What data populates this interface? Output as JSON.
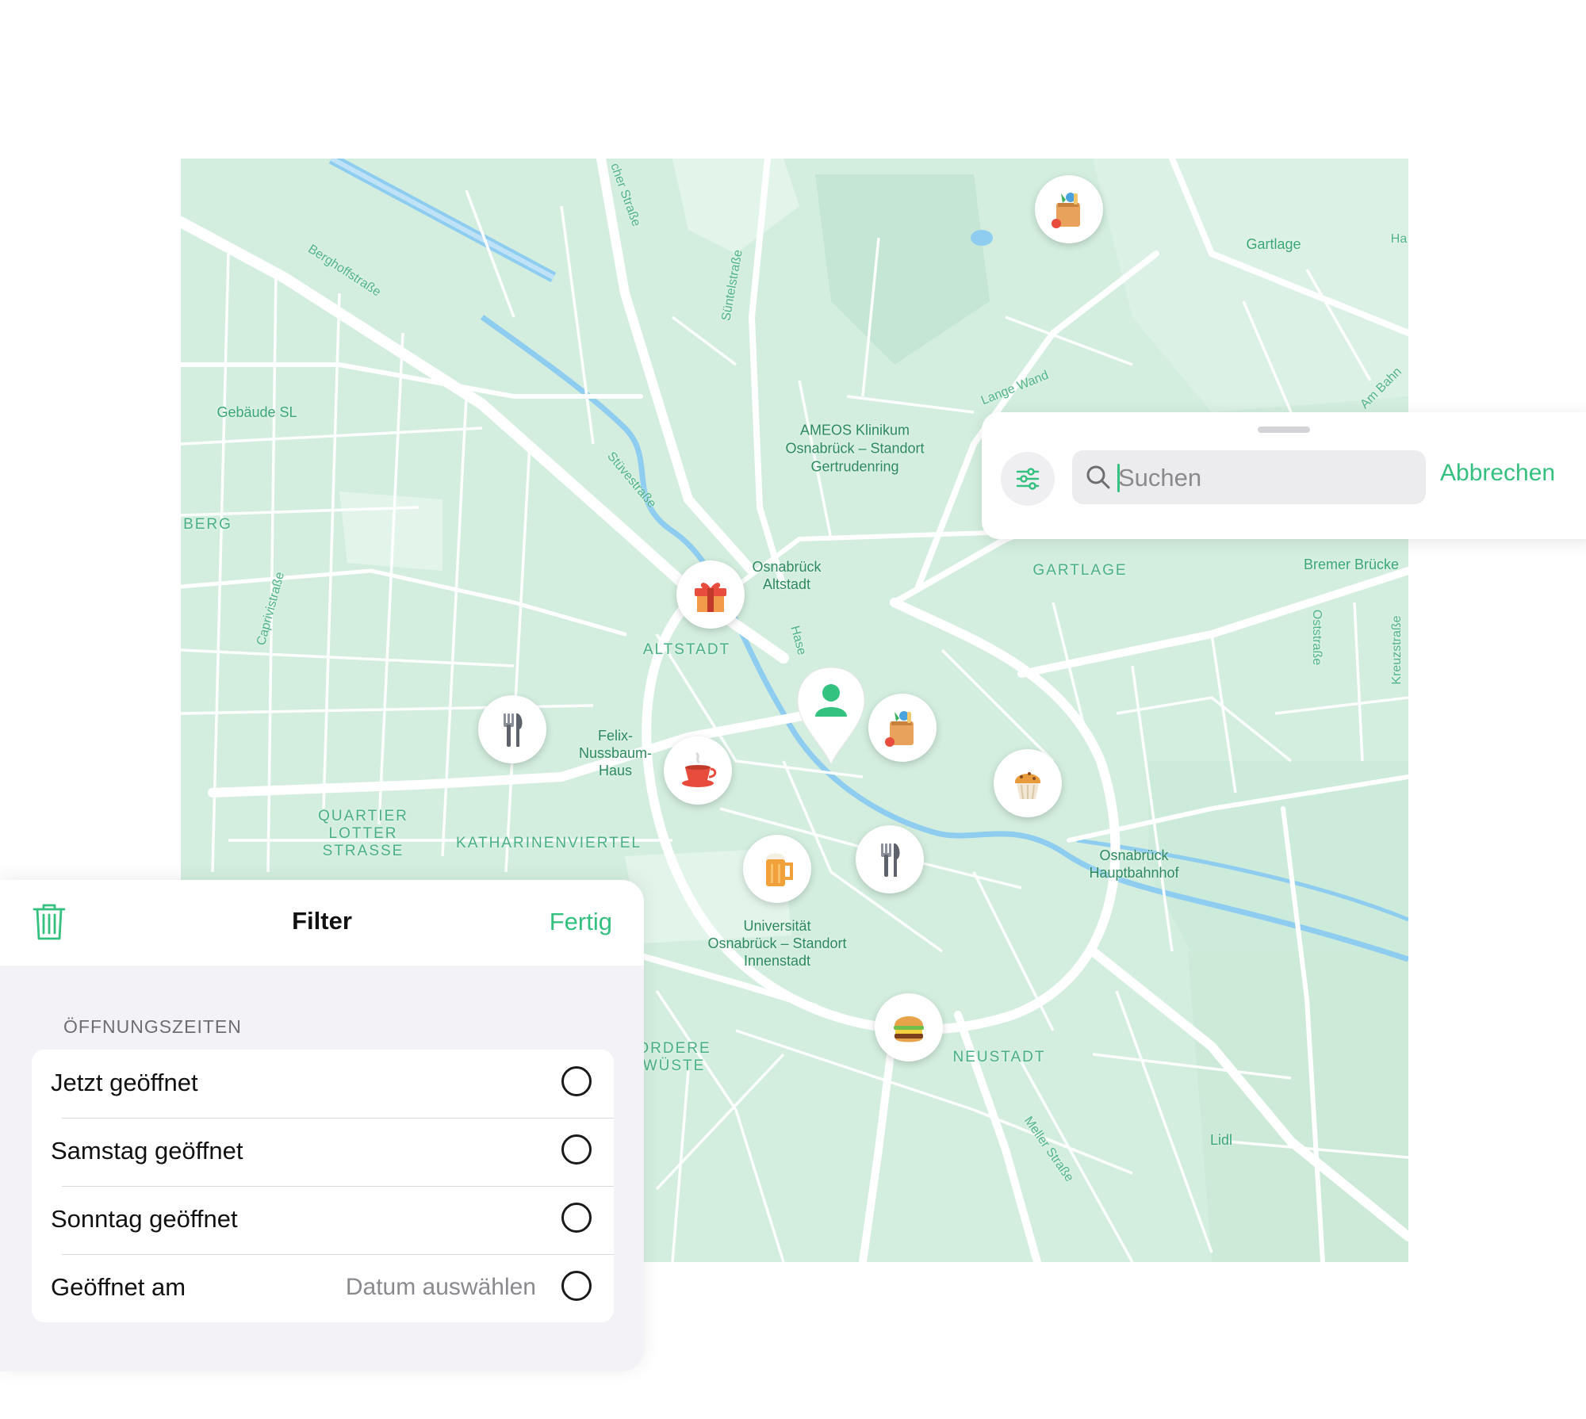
{
  "map": {
    "labels": [
      {
        "text": "Gebäude SL",
        "kind": "place"
      },
      {
        "text": "BERG",
        "kind": "district"
      },
      {
        "text": "Berghoffstraße",
        "kind": "street"
      },
      {
        "text": "Caprivistraße",
        "kind": "street"
      },
      {
        "text": "Süntelstraße",
        "kind": "street"
      },
      {
        "text": "Stüvestraße",
        "kind": "street"
      },
      {
        "text": "cher Straße",
        "kind": "street"
      },
      {
        "text": "AMEOS Klinikum\nOsnabrück – Standort\nGertrudenring",
        "kind": "place"
      },
      {
        "text": "Lange Wand",
        "kind": "street"
      },
      {
        "text": "Gartlage",
        "kind": "place"
      },
      {
        "text": "Ha",
        "kind": "street"
      },
      {
        "text": "Am Bahn",
        "kind": "street"
      },
      {
        "text": "Osnabrück\nAltstadt",
        "kind": "place"
      },
      {
        "text": "ALTSTADT",
        "kind": "district"
      },
      {
        "text": "Hase",
        "kind": "street"
      },
      {
        "text": "GARTLAGE",
        "kind": "district"
      },
      {
        "text": "Bremer Brücke",
        "kind": "place"
      },
      {
        "text": "Oststraße",
        "kind": "street"
      },
      {
        "text": "Kreuzstraße",
        "kind": "street"
      },
      {
        "text": "Felix-\nNussbaum-\nHaus",
        "kind": "place"
      },
      {
        "text": "QUARTIER\nLOTTER\nSTRASSE",
        "kind": "district"
      },
      {
        "text": "KATHARINENVIERTEL",
        "kind": "district"
      },
      {
        "text": "Osnabrück\nHauptbahnhof",
        "kind": "place"
      },
      {
        "text": "Universität\nOsnabrück – Standort\nInnenstadt",
        "kind": "place"
      },
      {
        "text": "ORDERE\nWÜSTE",
        "kind": "district"
      },
      {
        "text": "NEUSTADT",
        "kind": "district"
      },
      {
        "text": "Meller Straße",
        "kind": "street"
      },
      {
        "text": "Lidl",
        "kind": "place"
      }
    ],
    "markers": [
      {
        "icon": "grocery-bag-icon"
      },
      {
        "icon": "gift-icon"
      },
      {
        "icon": "cutlery-icon"
      },
      {
        "icon": "coffee-cup-icon"
      },
      {
        "icon": "grocery-bag-icon"
      },
      {
        "icon": "muffin-icon"
      },
      {
        "icon": "beer-mug-icon"
      },
      {
        "icon": "cutlery-icon"
      },
      {
        "icon": "burger-icon"
      }
    ],
    "user_location_icon": "person-pin-icon",
    "colors": {
      "land": "#d3eedf",
      "road": "#ffffff",
      "water": "#8fcdf0",
      "label": "#3aa775"
    }
  },
  "search": {
    "placeholder": "Suchen",
    "value": "",
    "cancel_label": "Abbrechen",
    "filter_icon": "sliders-icon",
    "search_icon": "magnifier-icon"
  },
  "filter": {
    "title": "Filter",
    "done_label": "Fertig",
    "clear_icon": "trash-icon",
    "section_title": "ÖFFNUNGSZEITEN",
    "options": [
      {
        "label": "Jetzt geöffnet",
        "detail": "",
        "selected": false
      },
      {
        "label": "Samstag geöffnet",
        "detail": "",
        "selected": false
      },
      {
        "label": "Sonntag geöffnet",
        "detail": "",
        "selected": false
      },
      {
        "label": "Geöffnet am",
        "detail": "Datum auswählen",
        "selected": false
      }
    ]
  },
  "accent_color": "#34c07f"
}
